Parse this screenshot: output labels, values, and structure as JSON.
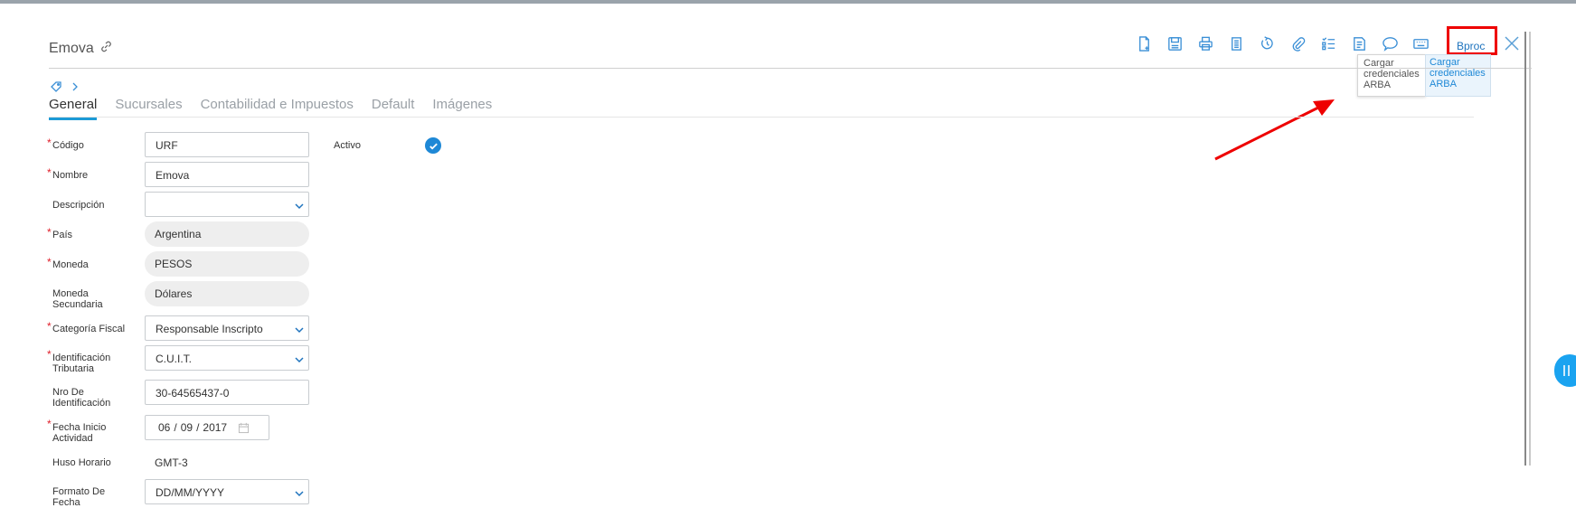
{
  "header": {
    "title": "Emova"
  },
  "toolbar": {
    "icons": [
      "new-document-icon",
      "save-icon",
      "print-icon",
      "copy-icon",
      "refresh-icon",
      "attachment-icon",
      "checklist-icon",
      "report-icon",
      "chat-icon",
      "keyboard-icon"
    ],
    "bproc_label": "Bproc",
    "close_icon": "close-icon"
  },
  "bproc_menu": {
    "item_plain": "Cargar credenciales ARBA",
    "item_highlighted": "Cargar credenciales ARBA"
  },
  "tabs": [
    {
      "label": "General",
      "active": true
    },
    {
      "label": "Sucursales",
      "active": false
    },
    {
      "label": "Contabilidad e Impuestos",
      "active": false
    },
    {
      "label": "Default",
      "active": false
    },
    {
      "label": "Imágenes",
      "active": false
    }
  ],
  "form": {
    "codigo": {
      "label": "Código",
      "value": "URF",
      "required": true
    },
    "nombre": {
      "label": "Nombre",
      "value": "Emova",
      "required": true
    },
    "descripcion": {
      "label": "Descripción",
      "value": "",
      "required": false
    },
    "pais": {
      "label": "País",
      "value": "Argentina",
      "required": true
    },
    "moneda": {
      "label": "Moneda",
      "value": "PESOS",
      "required": true
    },
    "moneda_secundaria": {
      "label_line1": "Moneda",
      "label_line2": "Secundaria",
      "value": "Dólares",
      "required": false
    },
    "categoria_fiscal": {
      "label": "Categoría Fiscal",
      "value": "Responsable Inscripto",
      "required": true
    },
    "identificacion_tributaria": {
      "label_line1": "Identificación",
      "label_line2": "Tributaria",
      "value": "C.U.I.T.",
      "required": true
    },
    "nro_identificacion": {
      "label_line1": "Nro De",
      "label_line2": "Identificación",
      "value": "30-64565437-0",
      "required": false
    },
    "fecha_inicio": {
      "label_line1": "Fecha Inicio",
      "label_line2": "Actividad",
      "day": "06",
      "month": "09",
      "year": "2017",
      "sep": "/",
      "required": true
    },
    "huso_horario": {
      "label": "Huso Horario",
      "value": "GMT-3"
    },
    "formato_fecha": {
      "label_line1": "Formato De",
      "label_line2": "Fecha",
      "value": "DD/MM/YYYY"
    },
    "activo": {
      "label": "Activo",
      "checked": true
    }
  },
  "colors": {
    "accent": "#1e88d6",
    "annotation": "#ee0000",
    "required": "#e0212c"
  }
}
